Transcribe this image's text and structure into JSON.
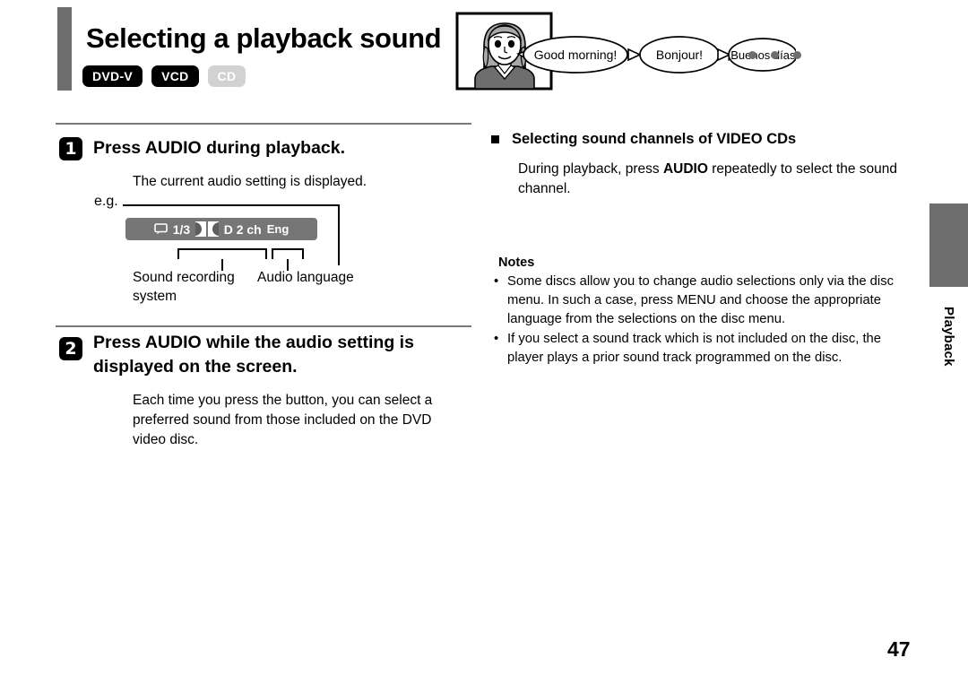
{
  "page": {
    "title": "Selecting a playback sound",
    "number": "47",
    "side_tab_label": "Playback",
    "accent_gray": "#6e6e6e"
  },
  "disc_badges": [
    {
      "label": "DVD-V",
      "state": "on"
    },
    {
      "label": "VCD",
      "state": "on"
    },
    {
      "label": "CD",
      "state": "off"
    }
  ],
  "illustration": {
    "name": "tv-woman-speech-bubbles",
    "bubbles": [
      "Good morning!",
      "Bonjour!",
      "¡Buenos días!"
    ],
    "ellipsis_dots": 3
  },
  "steps": [
    {
      "number": "1",
      "heading": "Press AUDIO during playback.",
      "body": "The current audio setting is displayed."
    },
    {
      "number": "2",
      "heading": "Press AUDIO while the audio setting is displayed on the screen.",
      "body": "Each time you press the button, you can select a preferred sound from those included on the DVD video disc."
    }
  ],
  "example": {
    "eg_label": "e.g.",
    "osd": {
      "subtitle_icon": "speech-balloon-icon",
      "track": "1/3",
      "dolby_logo": "dolby-digital-icon",
      "format": "D 2 ch",
      "language": "Eng",
      "background": "#767676"
    },
    "callouts": {
      "sound_system": "Sound recording system",
      "audio_language": "Audio language"
    }
  },
  "right_column": {
    "heading": "Selecting sound channels of VIDEO CDs",
    "intro_pre": "During playback, press ",
    "intro_bold": "AUDIO",
    "intro_post": " repeatedly to select the sound channel.",
    "notes_title": "Notes",
    "notes": [
      "Some discs allow you to change audio selections only via the disc menu. In such a case, press MENU and choose the appropriate language from the selections on the disc menu.",
      "If you select a sound track which is not included on the disc, the player plays a prior sound track programmed on the disc."
    ],
    "bullet_char": "•"
  }
}
